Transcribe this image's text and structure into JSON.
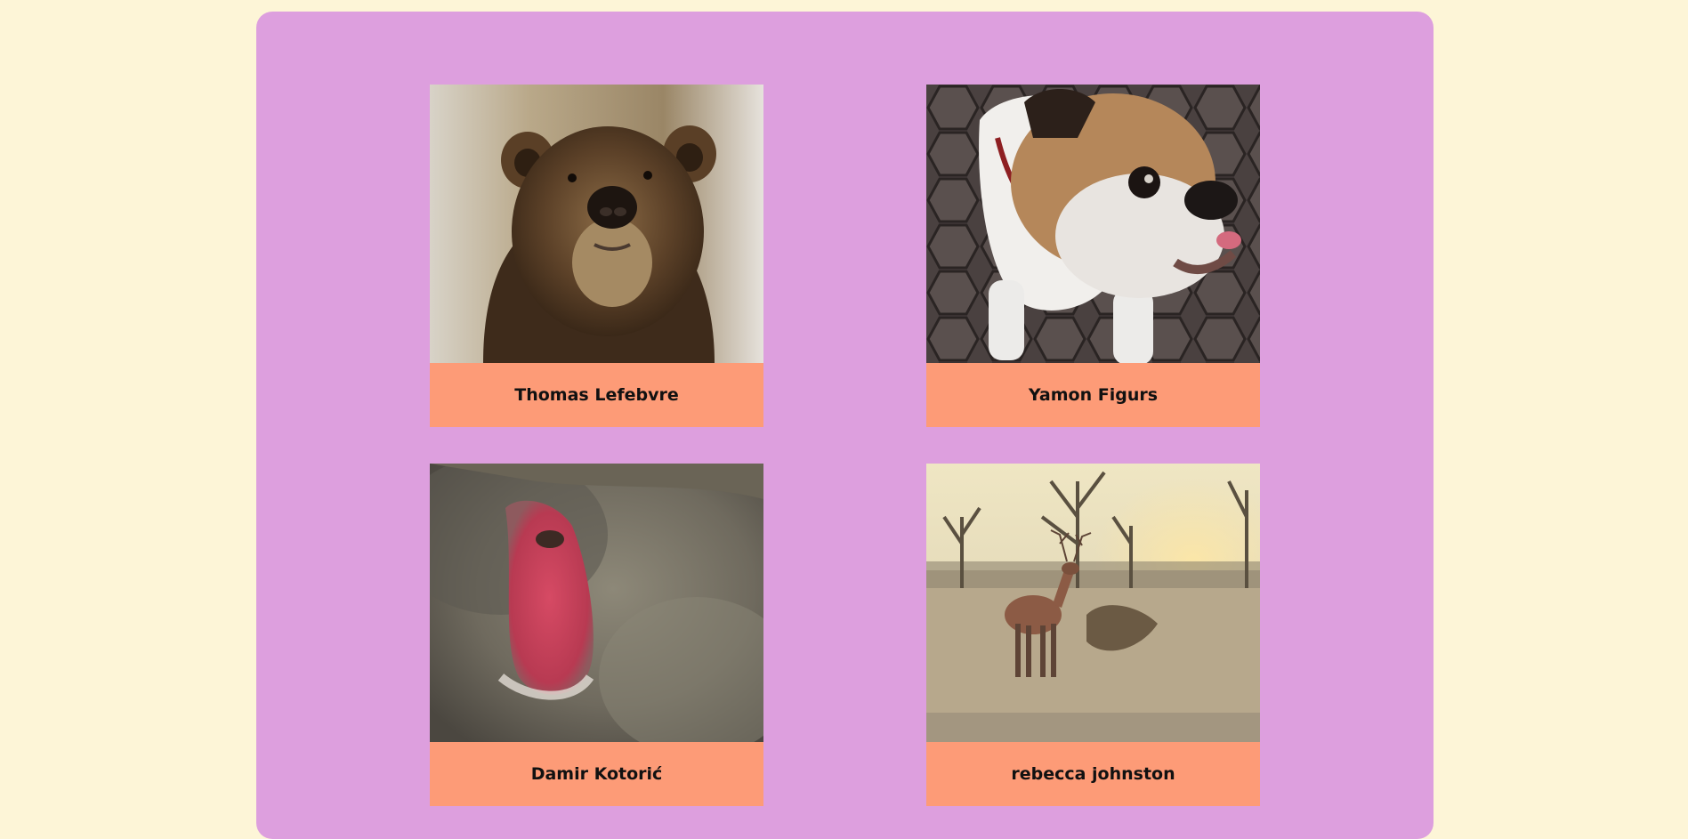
{
  "gallery": {
    "cards": [
      {
        "name": "Thomas Lefebvre",
        "image": "brown-bear-photo"
      },
      {
        "name": "Yamon Figurs",
        "image": "bulldog-photo"
      },
      {
        "name": "Damir Kotorić",
        "image": "macaque-photo"
      },
      {
        "name": "rebecca johnston",
        "image": "deer-photo"
      }
    ]
  },
  "colors": {
    "page_background": "#fdf5d7",
    "panel_background": "#dd9fde",
    "caption_background": "#fd9b77",
    "caption_text": "#111111"
  }
}
